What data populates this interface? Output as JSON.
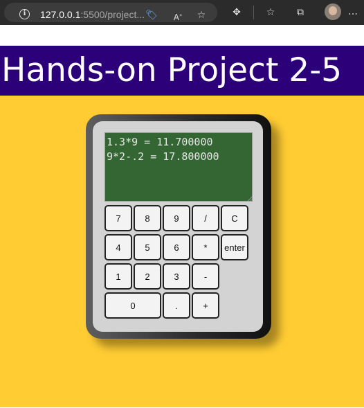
{
  "browser": {
    "url_host": "127.0.0.1",
    "url_rest": ":5500/project...",
    "icons": [
      "info-icon",
      "tag-icon",
      "read-aloud-icon",
      "favorite-add-icon",
      "extensions-icon",
      "favorites-icon",
      "collections-icon",
      "profile-avatar",
      "more-icon"
    ]
  },
  "page": {
    "title": "Hands-on Project 2-5"
  },
  "calculator": {
    "display_text": "1.3*9 = 11.700000\n9*2-.2 = 17.800000",
    "keys": {
      "k7": "7",
      "k8": "8",
      "k9": "9",
      "kdiv": "/",
      "kclear": "C",
      "k4": "4",
      "k5": "5",
      "k6": "6",
      "kmul": "*",
      "kenter": "enter",
      "k1": "1",
      "k2": "2",
      "k3": "3",
      "ksub": "-",
      "k0": "0",
      "kdot": ".",
      "kadd": "+"
    }
  },
  "colors": {
    "header_bg": "#2c0079",
    "page_bg": "#ffcc33",
    "display_bg": "#336633"
  }
}
